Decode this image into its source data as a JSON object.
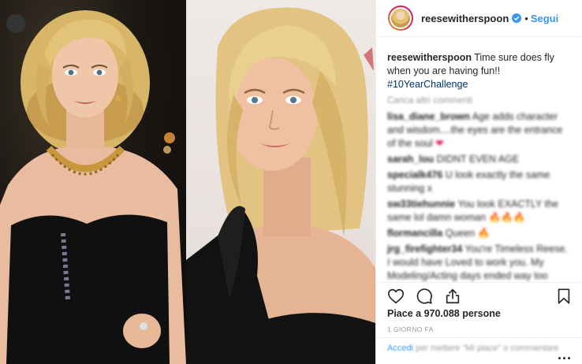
{
  "header": {
    "username": "reesewitherspoon",
    "separator": "•",
    "follow_label": "Segui",
    "verified_icon": "verified-badge-icon",
    "accent": "#3897f0"
  },
  "caption": {
    "username": "reesewitherspoon",
    "text": "Time sure does fly when you are having fun!!",
    "hashtag": "#10YearChallenge"
  },
  "load_more": "Carica altri commenti",
  "comments": [
    {
      "user": "lisa_diane_brown",
      "text": "Age adds character and wisdom....the eyes are the entrance of the soul",
      "emoji": "❤"
    },
    {
      "user": "sarah_lou",
      "text": "DIDNT EVEN AGE",
      "emoji": ""
    },
    {
      "user": "specialk476",
      "text": "U look exactly the same stunning x",
      "emoji": ""
    },
    {
      "user": "sw33tiehunnie",
      "text": "You look EXACTLY the same lol damn woman",
      "emoji": "🔥🔥🔥"
    },
    {
      "user": "flormancilla",
      "text": "Queen",
      "emoji": "🔥"
    },
    {
      "user": "jrg_firefighter34",
      "text": "You're Timeless Reese. I would have Loved to work you. My Modeling/Acting days ended way too soon. I was the head of Speech & Drama in High School. I was also MVP My senior year and had to choose. Through my arm out as I was",
      "emoji": ""
    }
  ],
  "actions": {
    "like_icon": "heart-icon",
    "comment_icon": "comment-icon",
    "share_icon": "share-icon",
    "save_icon": "bookmark-icon"
  },
  "likes": "Piace a 970.088 persone",
  "timestamp": "1 GIORNO FA",
  "add_comment": {
    "login_link": "Accedi",
    "rest": "per mettere \"Mi piace\" o commentare",
    "more_icon": "more-options-icon",
    "more_label": "..."
  }
}
